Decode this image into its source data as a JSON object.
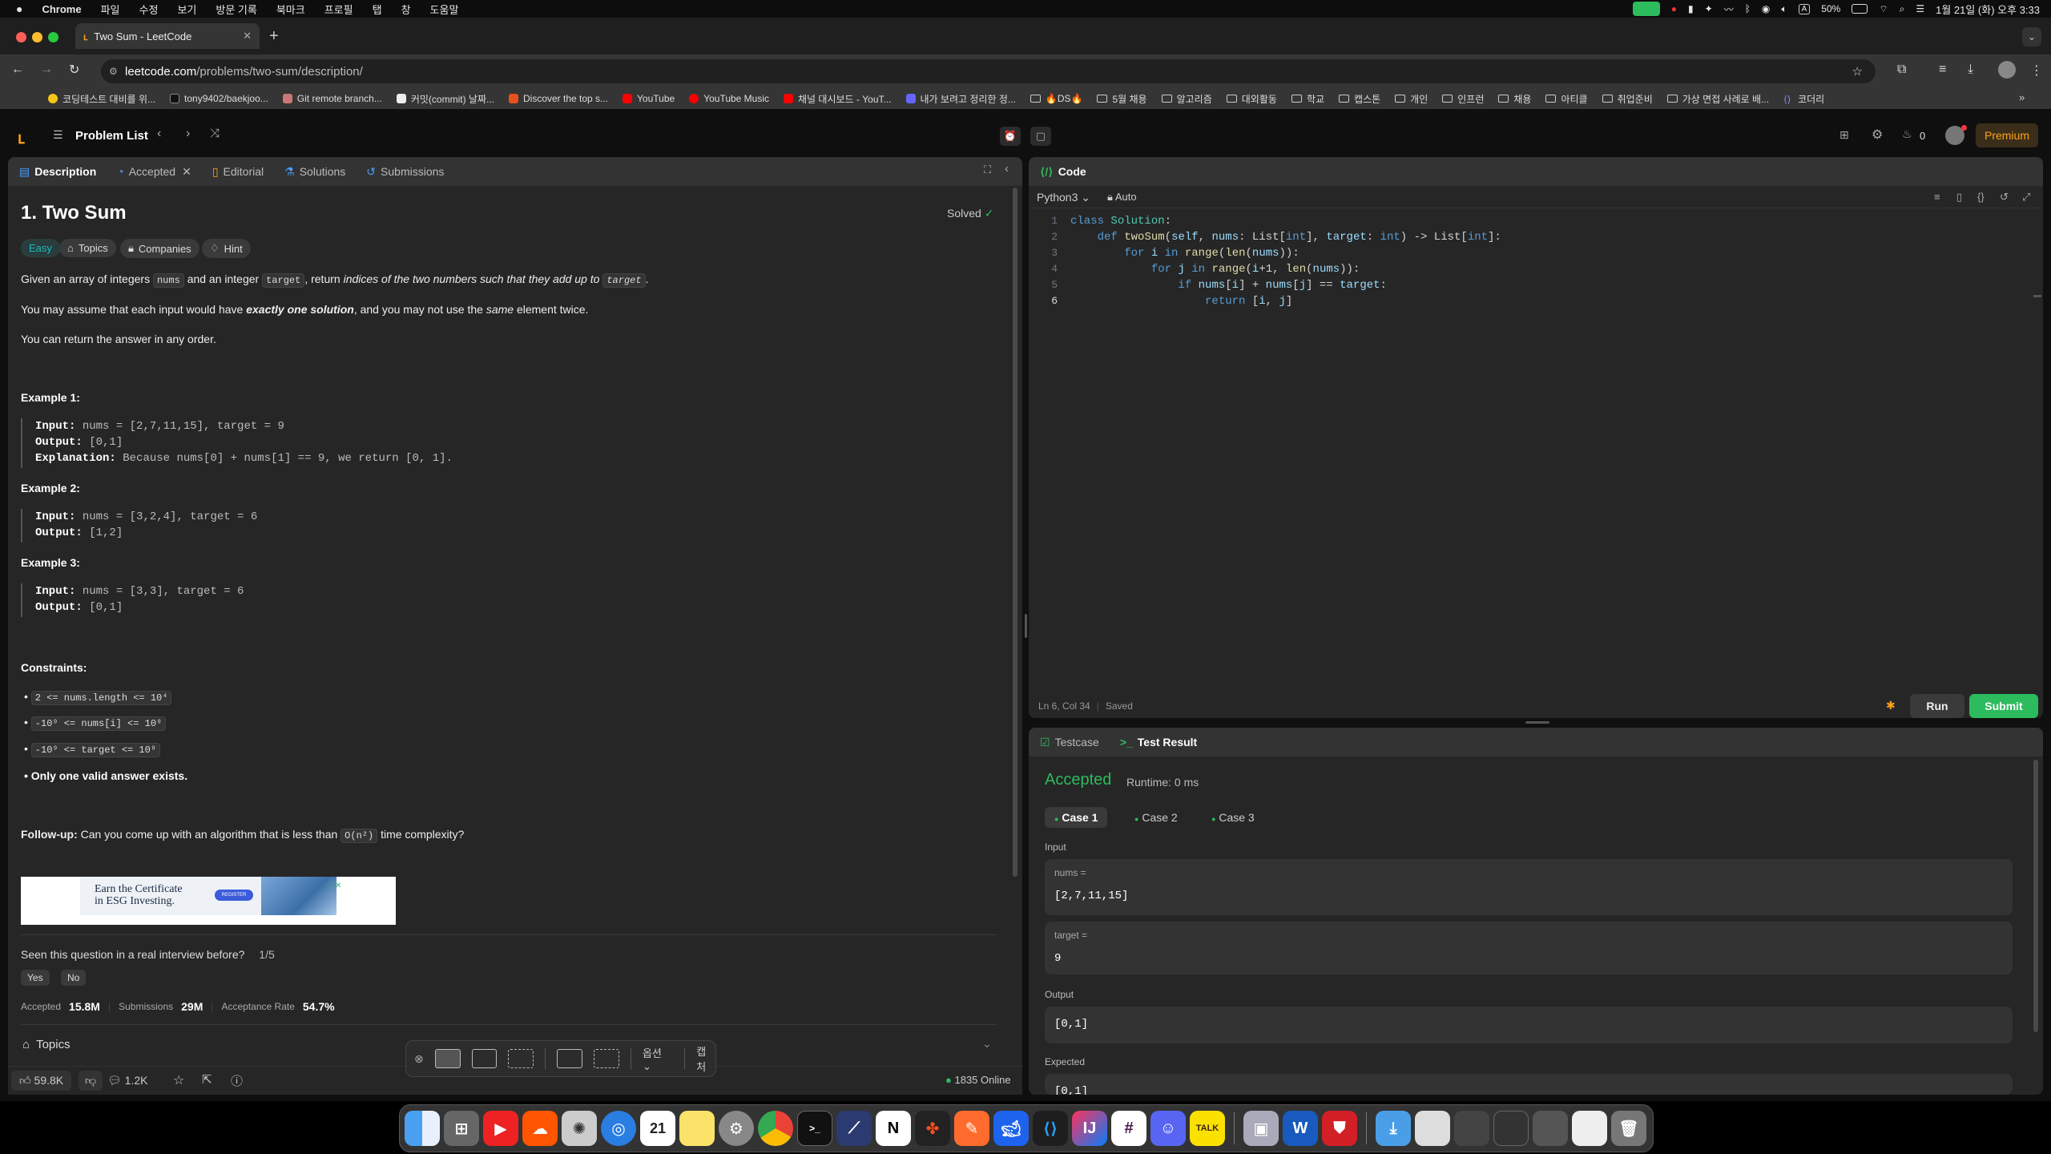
{
  "menubar": {
    "app": "Chrome",
    "items": [
      "파일",
      "수정",
      "보기",
      "방문 기록",
      "북마크",
      "프로필",
      "탭",
      "창",
      "도움말"
    ],
    "battery": "50%",
    "clock": "1월 21일 (화) 오후 3:33",
    "input_mode": "A"
  },
  "browser": {
    "tab_title": "Two Sum - LeetCode",
    "url_host": "leetcode.com",
    "url_path": "/problems/two-sum/description/",
    "bookmarks": [
      {
        "label": "코딩테스트 대비를 위...",
        "color": "#f5c518"
      },
      {
        "label": "tony9402/baekjoo...",
        "color": "#222"
      },
      {
        "label": "Git remote branch...",
        "color": "#c77"
      },
      {
        "label": "커밋(commit) 날짜...",
        "color": "#eee"
      },
      {
        "label": "Discover the top s...",
        "color": "#e8501e"
      },
      {
        "label": "YouTube",
        "color": "#f00"
      },
      {
        "label": "YouTube Music",
        "color": "#f00"
      },
      {
        "label": "채널 대시보드 - YouT...",
        "color": "#f00"
      },
      {
        "label": "내가 보려고 정리한 정...",
        "color": "#66f"
      },
      {
        "label": "🔥DS🔥",
        "color": ""
      },
      {
        "label": "5월 채용",
        "color": ""
      },
      {
        "label": "알고리즘",
        "color": ""
      },
      {
        "label": "대외활동",
        "color": ""
      },
      {
        "label": "학교",
        "color": ""
      },
      {
        "label": "캡스톤",
        "color": ""
      },
      {
        "label": "개인",
        "color": ""
      },
      {
        "label": "인프런",
        "color": ""
      },
      {
        "label": "채용",
        "color": ""
      },
      {
        "label": "아티클",
        "color": ""
      },
      {
        "label": "취업준비",
        "color": ""
      },
      {
        "label": "가상 면접 사례로 배...",
        "color": ""
      },
      {
        "label": "코더리",
        "color": "#88f"
      }
    ]
  },
  "nav": {
    "problem_list": "Problem List",
    "notifications": "0",
    "premium": "Premium"
  },
  "left_tabs": {
    "description": "Description",
    "accepted": "Accepted",
    "editorial": "Editorial",
    "solutions": "Solutions",
    "submissions": "Submissions"
  },
  "problem": {
    "title": "1. Two Sum",
    "status": "Solved",
    "difficulty": "Easy",
    "topics_pill": "Topics",
    "companies_pill": "Companies",
    "hint_pill": "Hint",
    "p1_a": "Given an array of integers",
    "p1_nums": "nums",
    "p1_b": "and an integer",
    "p1_target": "target",
    "p1_c": ", return",
    "p1_d": "indices of the two numbers such that they add up to",
    "p1_target2": "target",
    "p1_e": ".",
    "p2_a": "You may assume that each input would have",
    "p2_b": "exactly one solution",
    "p2_c": ", and you may not use the",
    "p2_d": "same",
    "p2_e": "element twice.",
    "p3": "You can return the answer in any order.",
    "examples": [
      {
        "heading": "Example 1:",
        "input_label": "Input:",
        "input": "nums = [2,7,11,15], target = 9",
        "output_label": "Output:",
        "output": "[0,1]",
        "explanation_label": "Explanation:",
        "explanation": "Because nums[0] + nums[1] == 9, we return [0, 1]."
      },
      {
        "heading": "Example 2:",
        "input_label": "Input:",
        "input": "nums = [3,2,4], target = 6",
        "output_label": "Output:",
        "output": "[1,2]"
      },
      {
        "heading": "Example 3:",
        "input_label": "Input:",
        "input": "nums = [3,3], target = 6",
        "output_label": "Output:",
        "output": "[0,1]"
      }
    ],
    "constraints_heading": "Constraints:",
    "constraints": [
      "2 <= nums.length <= 10⁴",
      "-10⁹ <= nums[i] <= 10⁹",
      "-10⁹ <= target <= 10⁹"
    ],
    "constraint_bold": "Only one valid answer exists.",
    "followup_label": "Follow-up:",
    "followup_a": "Can you come up with an algorithm that is less than",
    "followup_code": "O(n²)",
    "followup_b": "time complexity?",
    "ad_text_1": "Earn the Certificate",
    "ad_text_2": "in ESG Investing.",
    "ad_button": "REGISTER",
    "interview_q": "Seen this question in a real interview before?",
    "interview_count": "1/5",
    "yes": "Yes",
    "no": "No",
    "accepted_label": "Accepted",
    "accepted_val": "15.8M",
    "submissions_label": "Submissions",
    "submissions_val": "29M",
    "rate_label": "Acceptance Rate",
    "rate_val": "54.7%",
    "topics_section": "Topics",
    "likes": "59.8K",
    "comments": "1.2K",
    "online": "1835 Online"
  },
  "editor": {
    "header": "Code",
    "language": "Python3",
    "auto": "Auto",
    "status_pos": "Ln 6, Col 34",
    "status_saved": "Saved",
    "run": "Run",
    "submit": "Submit"
  },
  "result": {
    "tab_testcase": "Testcase",
    "tab_result": "Test Result",
    "verdict": "Accepted",
    "runtime": "Runtime: 0 ms",
    "cases": [
      "Case 1",
      "Case 2",
      "Case 3"
    ],
    "input_heading": "Input",
    "nums_label": "nums =",
    "nums_val": "[2,7,11,15]",
    "target_label": "target =",
    "target_val": "9",
    "output_heading": "Output",
    "output_val": "[0,1]",
    "expected_heading": "Expected",
    "expected_val": "[0,1]"
  },
  "screenshot_toolbar": {
    "options": "옵션",
    "capture": "캡처"
  },
  "colors": {
    "accent_green": "#2cbb5d",
    "easy": "#1cbaba",
    "premium": "#ffa116"
  }
}
